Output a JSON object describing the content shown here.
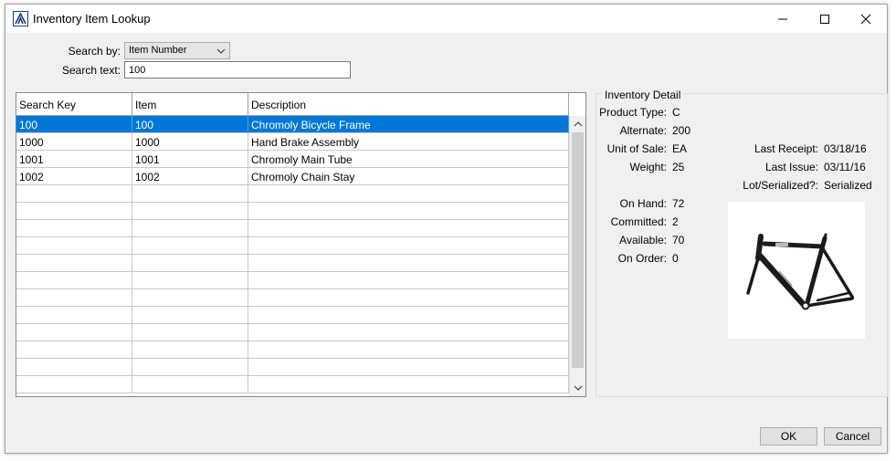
{
  "window": {
    "title": "Inventory Item Lookup"
  },
  "search": {
    "by_label": "Search by:",
    "by_value": "Item Number",
    "text_label": "Search text:",
    "text_value": "100"
  },
  "grid": {
    "headers": [
      "Search Key",
      "Item",
      "Description"
    ],
    "rows": [
      {
        "key": "100",
        "item": "100",
        "description": "Chromoly Bicycle Frame"
      },
      {
        "key": "1000",
        "item": "1000",
        "description": "Hand Brake Assembly"
      },
      {
        "key": "1001",
        "item": "1001",
        "description": "Chromoly Main Tube"
      },
      {
        "key": "1002",
        "item": "1002",
        "description": "Chromoly Chain Stay"
      }
    ],
    "selected_index": 0
  },
  "detail": {
    "title": "Inventory Detail",
    "product_type": {
      "label": "Product Type:",
      "value": "C"
    },
    "alternate": {
      "label": "Alternate:",
      "value": "200"
    },
    "unit_of_sale": {
      "label": "Unit of Sale:",
      "value": "EA"
    },
    "weight": {
      "label": "Weight:",
      "value": "25"
    },
    "last_receipt": {
      "label": "Last Receipt:",
      "value": "03/18/16"
    },
    "last_issue": {
      "label": "Last Issue:",
      "value": "03/11/16"
    },
    "lot_serialized": {
      "label": "Lot/Serialized?:",
      "value": "Serialized"
    },
    "on_hand": {
      "label": "On Hand:",
      "value": "72"
    },
    "committed": {
      "label": "Committed:",
      "value": "2"
    },
    "available": {
      "label": "Available:",
      "value": "70"
    },
    "on_order": {
      "label": "On Order:",
      "value": "0"
    }
  },
  "buttons": {
    "ok": "OK",
    "cancel": "Cancel"
  },
  "colors": {
    "selection": "#0078d7",
    "app_icon": "#1a3a8a"
  }
}
